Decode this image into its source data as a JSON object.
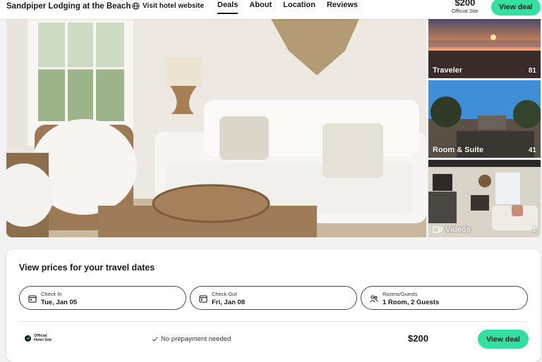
{
  "header": {
    "hotel_name": "Sandpiper Lodging at the Beach",
    "site_link": "Visit hotel website",
    "tabs": [
      {
        "label": "Deals",
        "active": true
      },
      {
        "label": "About",
        "active": false
      },
      {
        "label": "Location",
        "active": false
      },
      {
        "label": "Reviews",
        "active": false
      }
    ],
    "price": "$200",
    "price_source": "Official Site",
    "deal_button": "View deal"
  },
  "gallery": {
    "thumbnails": [
      {
        "label": "Traveler",
        "count": "81"
      },
      {
        "label": "Room & Suite",
        "count": "41"
      },
      {
        "label": "Videos",
        "count": "1"
      }
    ]
  },
  "prices": {
    "title": "View prices for your travel dates",
    "fields": [
      {
        "label": "Check In",
        "value": "Tue, Jan 05",
        "icon": "calendar-icon"
      },
      {
        "label": "Check Out",
        "value": "Fri, Jan 08",
        "icon": "calendar-icon"
      },
      {
        "label": "Rooms/Guests",
        "value": "1 Room, 2 Guests",
        "icon": "guests-icon"
      }
    ],
    "offer": {
      "provider_line1": "Official",
      "provider_line2": "Hotel Site",
      "note": "No prepayment needed",
      "price": "$200",
      "button": "View deal"
    }
  },
  "colors": {
    "accent": "#34e0a1",
    "text": "#1a1a1a",
    "background": "#f2f2f2"
  }
}
